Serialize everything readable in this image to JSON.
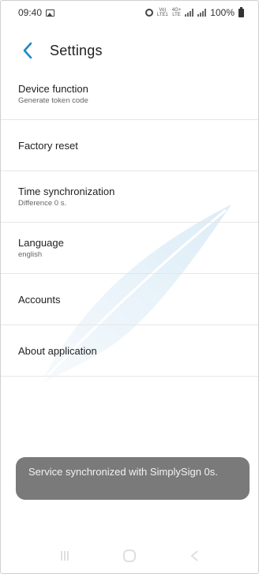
{
  "status_bar": {
    "time": "09:40",
    "volte_top": "Vo)",
    "volte_bottom": "LTE1",
    "net_top": "4G+",
    "net_bottom": "LTE",
    "battery": "100%"
  },
  "header": {
    "title": "Settings",
    "back_icon": "chevron-left-icon",
    "accent_color": "#1e88c8"
  },
  "settings": [
    {
      "title": "Device function",
      "subtitle": "Generate token code"
    },
    {
      "title": "Factory reset",
      "subtitle": ""
    },
    {
      "title": "Time synchronization",
      "subtitle": "Difference 0 s."
    },
    {
      "title": "Language",
      "subtitle": "english"
    },
    {
      "title": "Accounts",
      "subtitle": ""
    },
    {
      "title": "About application",
      "subtitle": ""
    }
  ],
  "toast": {
    "message": "Service synchronized with SimplySign 0s."
  },
  "nav": {
    "recents_icon": "recents-icon",
    "home_icon": "home-icon",
    "back_icon": "back-nav-icon"
  }
}
